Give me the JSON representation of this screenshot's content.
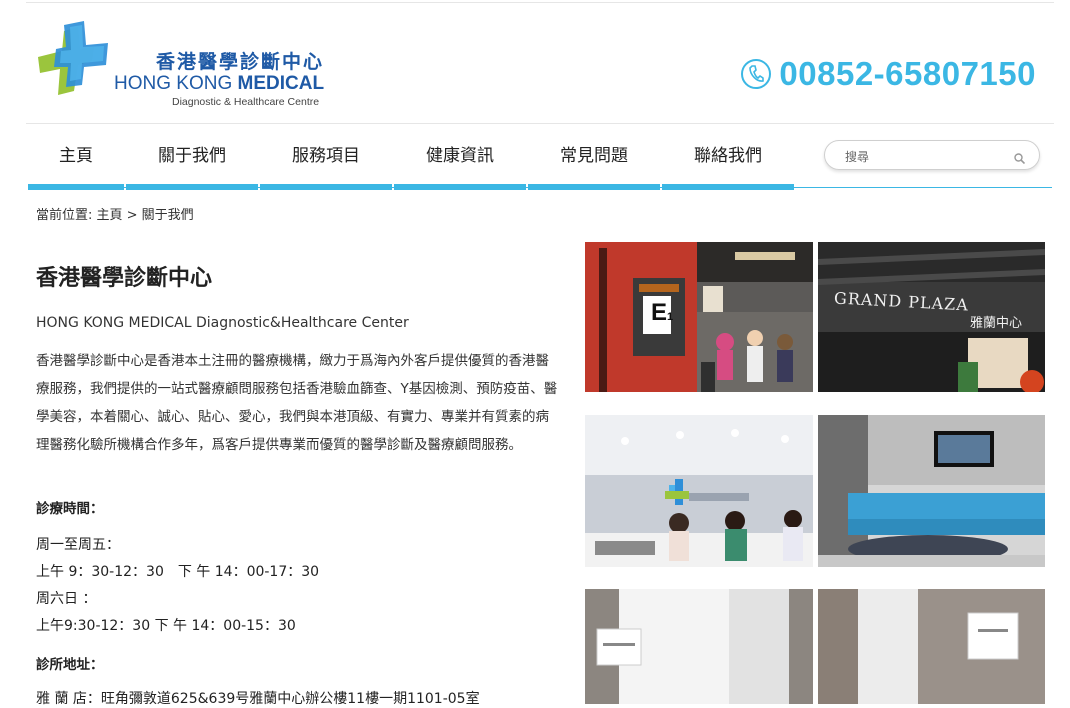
{
  "header": {
    "logo_cn": "香港醫學診斷中心",
    "logo_en_prefix": "HONG KONG ",
    "logo_en_bold": "MEDICAL",
    "logo_sub": "Diagnostic & Healthcare Centre",
    "phone": "00852-65807150"
  },
  "nav": {
    "items": [
      {
        "label": "主頁"
      },
      {
        "label": "關于我們"
      },
      {
        "label": "服務項目"
      },
      {
        "label": "健康資訊"
      },
      {
        "label": "常見問題"
      },
      {
        "label": "聯絡我們"
      }
    ],
    "search_placeholder": "搜尋"
  },
  "breadcrumb": "當前位置: 主頁 > 關于我們",
  "content": {
    "title": "香港醫學診斷中心",
    "en_name": "HONG KONG MEDICAL Diagnostic&Healthcare Center",
    "paragraph": "香港醫學診斷中心是香港本土注冊的醫療機構，緻力于爲海內外客戶提供優質的香港醫療服務，我們提供的一站式醫療顧問服務包括香港驗血篩查、Y基因檢測、預防疫苗、醫學美容，本着關心、誠心、貼心、愛心，我們與本港頂級、有實力、專業并有質素的病理醫務化驗所機構合作多年，爲客戶提供專業而優質的醫學診斷及醫療顧問服務。",
    "hours_heading": "診療時間：",
    "weekday_label": "周一至周五：",
    "weekday_hours": "上午 9：30-12：30　下 午 14：00-17：30",
    "saturday_label": "周六日 ：",
    "saturday_hours": "上午9:30-12：30 下 午 14：00-15：30",
    "address_heading": "診所地址：",
    "address": "雅 蘭 店：旺角彌敦道625&639号雅蘭中心辦公樓11樓一期1101-05室"
  },
  "photos": {
    "grand_plaza_sign": "GRAND PLAZA",
    "grand_plaza_cn": "雅蘭中心",
    "floor_sign": "E",
    "floor_sub": "1"
  },
  "colors": {
    "accent": "#3bb7e4",
    "logo_blue": "#1f5aa6",
    "logo_green": "#9bc53d"
  }
}
